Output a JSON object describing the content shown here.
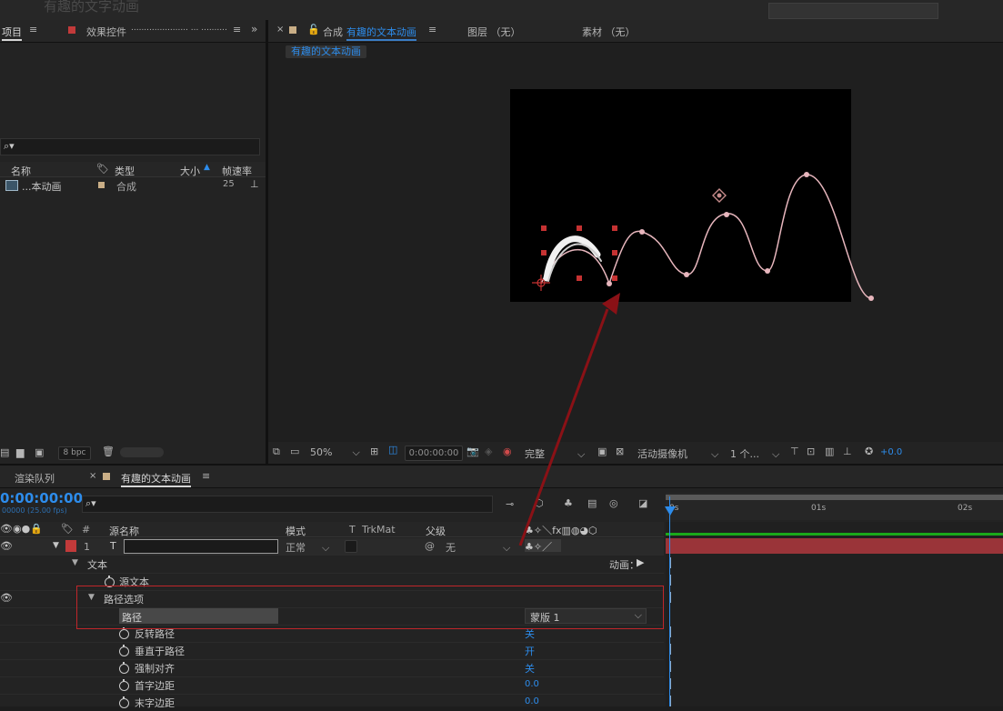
{
  "top_ghost_title": "有趣的文字动画",
  "project_panel": {
    "tab_label": "项目",
    "effects_tab_label": "效果控件",
    "effects_tab_value": "...................... ... ..........",
    "search_icon": "⌕▾",
    "columns": {
      "name": "名称",
      "type": "类型",
      "size": "大小",
      "fps": "帧速率"
    },
    "items": [
      {
        "name": "...本动画",
        "type": "合成",
        "fps": "25"
      }
    ],
    "bpc_label": "8 bpc"
  },
  "comp_panel": {
    "tab_prefix": "合成",
    "tab_name": "有趣的文本动画",
    "layer_tab": "图层 （无）",
    "footage_tab": "素材 （无）",
    "breadcrumb": "有趣的文本动画",
    "toolbar": {
      "zoom": "50%",
      "timecode": "0:00:00:00",
      "quality": "完整",
      "camera": "活动摄像机",
      "views": "1 个...",
      "exposure": "+0.0"
    }
  },
  "timeline": {
    "tabs": {
      "render_queue": "渲染队列",
      "comp": "有趣的文本动画"
    },
    "current_time": "0:00:00:00",
    "fps_note": "00000 (25.00 fps)",
    "search_icon": "⌕▾",
    "columns": {
      "num": "#",
      "source_name": "源名称",
      "mode": "模式",
      "t": "T",
      "trkmat": "TrkMat",
      "parent": "父级"
    },
    "ruler": [
      "0s",
      "01s",
      "02s"
    ],
    "layer": {
      "index": "1",
      "type_glyph": "T",
      "mode": "正常",
      "parent": "无"
    },
    "animate_label": "动画：",
    "props": [
      {
        "name": "文本",
        "level": 0,
        "twirl": "▼"
      },
      {
        "name": "源文本",
        "level": 1,
        "stopwatch": true
      },
      {
        "name": "路径选项",
        "level": 0,
        "twirl": "▼"
      },
      {
        "name": "路径",
        "level": 1,
        "value": "蒙版 1",
        "dropdown": true
      },
      {
        "name": "反转路径",
        "level": 1,
        "stopwatch": true,
        "value": "关"
      },
      {
        "name": "垂直于路径",
        "level": 1,
        "stopwatch": true,
        "value": "开"
      },
      {
        "name": "强制对齐",
        "level": 1,
        "stopwatch": true,
        "value": "关"
      },
      {
        "name": "首字边距",
        "level": 1,
        "stopwatch": true,
        "value": "0.0"
      },
      {
        "name": "末字边距",
        "level": 1,
        "stopwatch": true,
        "value": "0.0"
      }
    ]
  },
  "colors": {
    "accent_blue": "#2d8ceb",
    "label_red": "#c23a3a",
    "mask_pink": "#e7b6bd",
    "annot_red": "#c0262a",
    "bar_red": "#a7363c",
    "bar_green": "#1aa81a"
  }
}
